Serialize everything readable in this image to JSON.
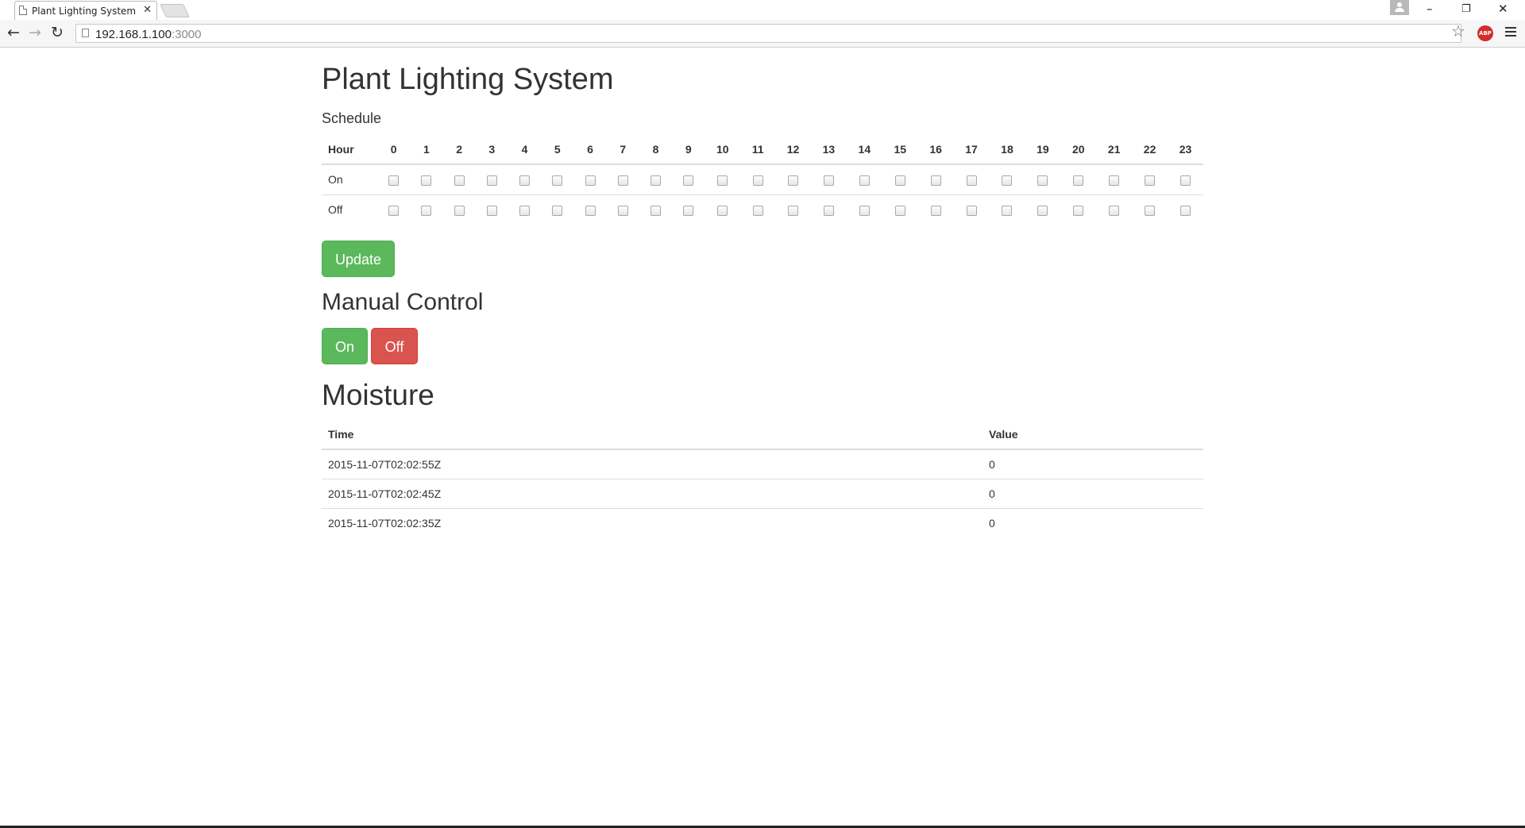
{
  "browser": {
    "tab_title": "Plant Lighting System",
    "tab_close": "✕",
    "url_host": "192.168.1.100",
    "url_port": ":3000",
    "icons": [
      "page-icon",
      "back-arrow-icon",
      "forward-arrow-icon",
      "reload-icon",
      "star-icon",
      "adblock-icon",
      "menu-icon",
      "minimize-icon",
      "restore-icon",
      "close-icon",
      "profile-icon"
    ],
    "abp_label": "ABP",
    "nav": {
      "back": "←",
      "forward": "→",
      "reload": "↻",
      "star": "☆"
    },
    "window": {
      "minimize": "–",
      "restore": "❐",
      "close": "✕"
    }
  },
  "page": {
    "title": "Plant Lighting System",
    "schedule": {
      "heading": "Schedule",
      "row_header": "Hour",
      "hours": [
        "0",
        "1",
        "2",
        "3",
        "4",
        "5",
        "6",
        "7",
        "8",
        "9",
        "10",
        "11",
        "12",
        "13",
        "14",
        "15",
        "16",
        "17",
        "18",
        "19",
        "20",
        "21",
        "22",
        "23"
      ],
      "rows": [
        {
          "label": "On",
          "checked": [
            false,
            false,
            false,
            false,
            false,
            false,
            false,
            false,
            false,
            false,
            false,
            false,
            false,
            false,
            false,
            false,
            false,
            false,
            false,
            false,
            false,
            false,
            false,
            false
          ]
        },
        {
          "label": "Off",
          "checked": [
            false,
            false,
            false,
            false,
            false,
            false,
            false,
            false,
            false,
            false,
            false,
            false,
            false,
            false,
            false,
            false,
            false,
            false,
            false,
            false,
            false,
            false,
            false,
            false
          ]
        }
      ],
      "update_label": "Update"
    },
    "manual": {
      "heading": "Manual Control",
      "on_label": "On",
      "off_label": "Off"
    },
    "moisture": {
      "heading": "Moisture",
      "columns": [
        "Time",
        "Value"
      ],
      "rows": [
        {
          "time": "2015-11-07T02:02:55Z",
          "value": "0"
        },
        {
          "time": "2015-11-07T02:02:45Z",
          "value": "0"
        },
        {
          "time": "2015-11-07T02:02:35Z",
          "value": "0"
        }
      ]
    },
    "colors": {
      "success": "#5cb85c",
      "danger": "#d9534f",
      "text": "#333333"
    }
  }
}
